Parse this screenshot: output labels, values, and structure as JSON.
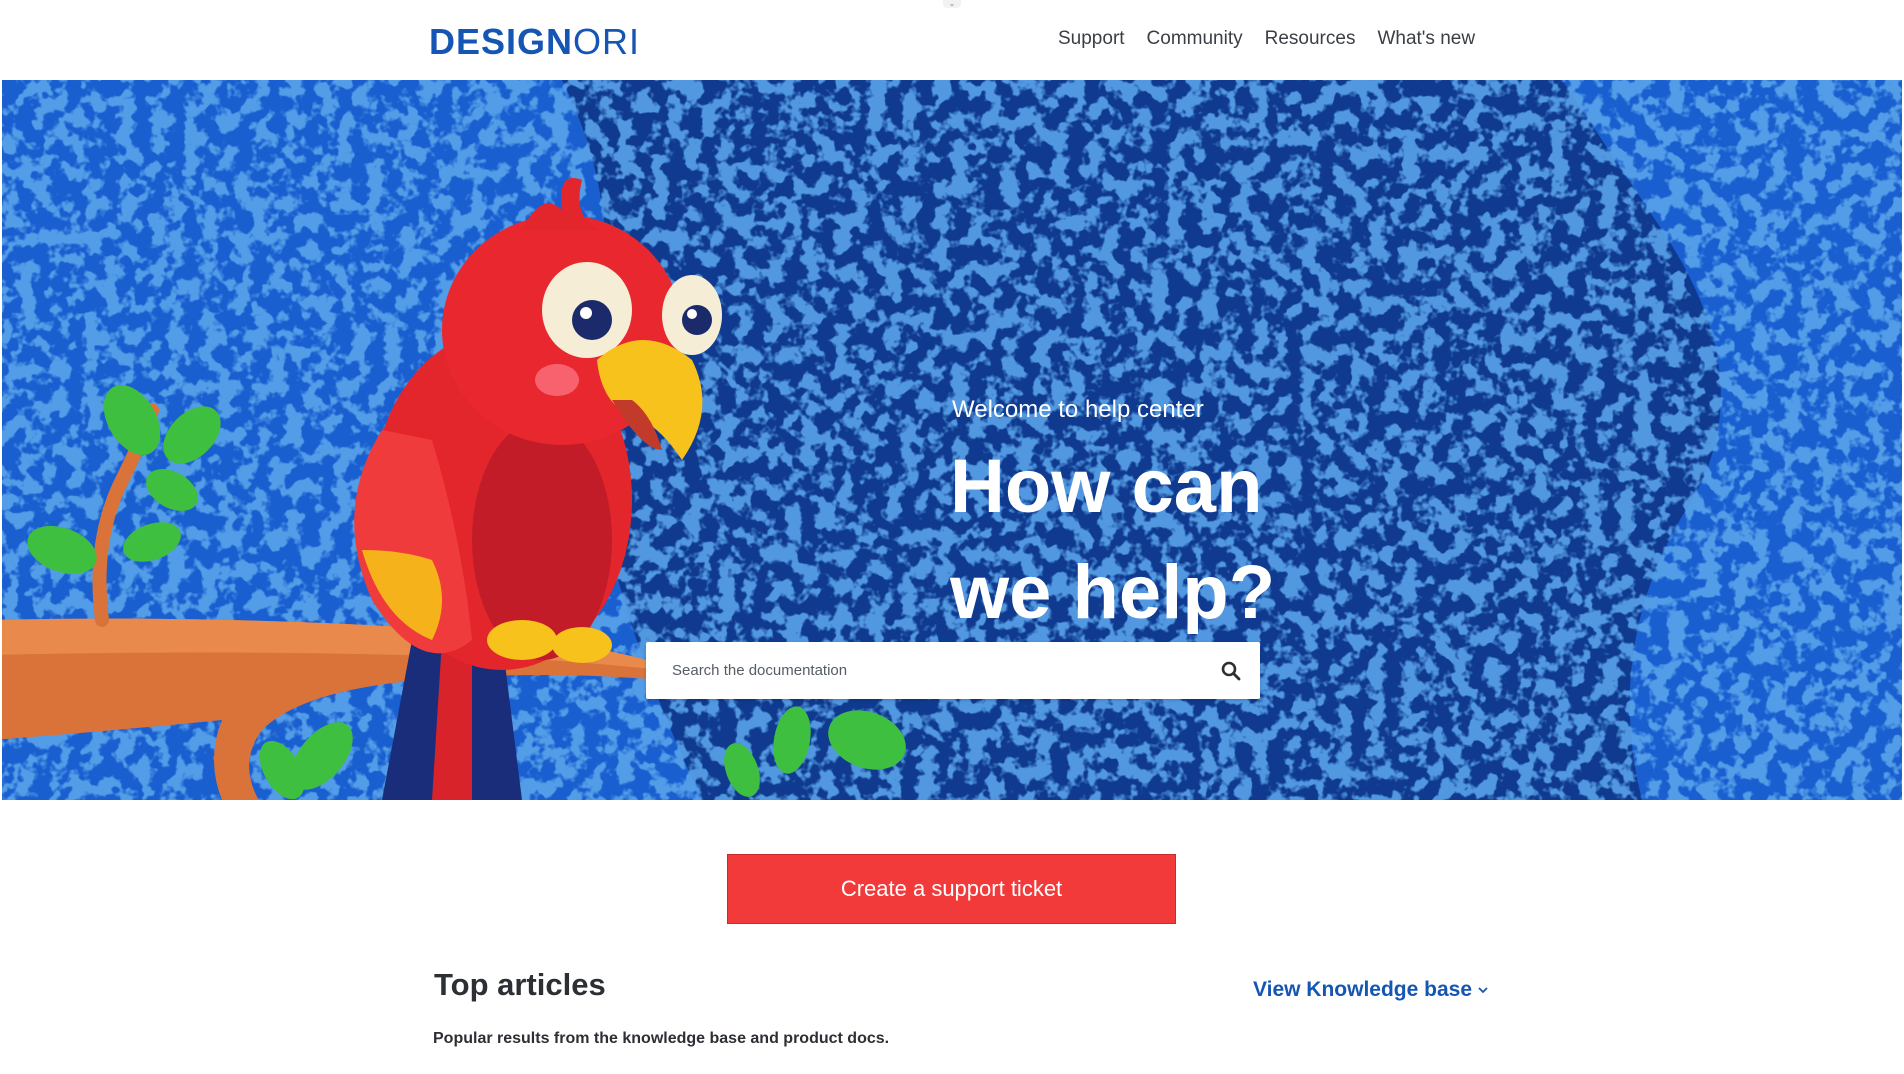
{
  "header": {
    "logo_bold": "DESIGN",
    "logo_light": "ORI",
    "nav": [
      "Support",
      "Community",
      "Resources",
      "What's new"
    ]
  },
  "hero": {
    "welcome": "Welcome to help center",
    "headline_line1": "How can",
    "headline_line2": "we help?",
    "search_placeholder": "Search the documentation"
  },
  "cta": {
    "label": "Create a support ticket"
  },
  "articles": {
    "title": "Top articles",
    "subtitle": "Popular results from the knowledge base and product docs.",
    "view_link": "View Knowledge base"
  },
  "colors": {
    "brand_blue": "#1556b5",
    "hero_dark": "#0f3a8f",
    "hero_bright": "#1a5fd0",
    "cta_red": "#f23a3a"
  },
  "icons": [
    "search-icon",
    "chevron-down-icon"
  ]
}
